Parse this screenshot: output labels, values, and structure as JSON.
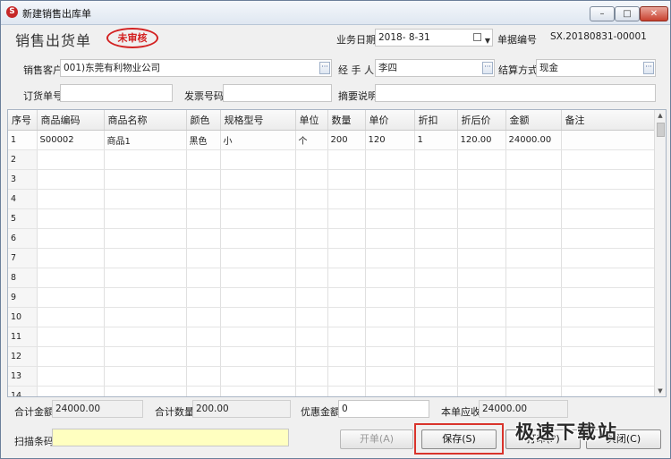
{
  "window": {
    "title": "新建销售出库单",
    "app_icon": "app-logo-icon",
    "controls": {
      "minimize": "–",
      "maximize": "□",
      "close": "✕"
    }
  },
  "header": {
    "doc_title": "销售出货单",
    "status_stamp": "未审核",
    "date_label": "业务日期",
    "date_value": "2018- 8-31",
    "doc_no_label": "单据编号",
    "doc_no_value": "SX.20180831-00001"
  },
  "form": {
    "customer_label": "销售客户",
    "customer_value": "001)东莞有利物业公司",
    "handler_label": "经 手 人",
    "handler_value": "李四",
    "settle_label": "结算方式",
    "settle_value": "现金",
    "order_no_label": "订货单号",
    "order_no_value": "",
    "invoice_no_label": "发票号码",
    "invoice_no_value": "",
    "remark_label": "摘要说明",
    "remark_value": "",
    "lookup_glyph": "···"
  },
  "grid": {
    "columns": [
      "序号",
      "商品编码",
      "商品名称",
      "颜色",
      "规格型号",
      "单位",
      "数量",
      "单价",
      "折扣",
      "折后价",
      "金额",
      "备注"
    ],
    "rows": [
      [
        "1",
        "S00002",
        "商品1",
        "黑色",
        "小",
        "个",
        "200",
        "120",
        "1",
        "120.00",
        "24000.00",
        ""
      ],
      [
        "2",
        "",
        "",
        "",
        "",
        "",
        "",
        "",
        "",
        "",
        "",
        ""
      ],
      [
        "3",
        "",
        "",
        "",
        "",
        "",
        "",
        "",
        "",
        "",
        "",
        ""
      ],
      [
        "4",
        "",
        "",
        "",
        "",
        "",
        "",
        "",
        "",
        "",
        "",
        ""
      ],
      [
        "5",
        "",
        "",
        "",
        "",
        "",
        "",
        "",
        "",
        "",
        "",
        ""
      ],
      [
        "6",
        "",
        "",
        "",
        "",
        "",
        "",
        "",
        "",
        "",
        "",
        ""
      ],
      [
        "7",
        "",
        "",
        "",
        "",
        "",
        "",
        "",
        "",
        "",
        "",
        ""
      ],
      [
        "8",
        "",
        "",
        "",
        "",
        "",
        "",
        "",
        "",
        "",
        "",
        ""
      ],
      [
        "9",
        "",
        "",
        "",
        "",
        "",
        "",
        "",
        "",
        "",
        "",
        ""
      ],
      [
        "10",
        "",
        "",
        "",
        "",
        "",
        "",
        "",
        "",
        "",
        "",
        ""
      ],
      [
        "11",
        "",
        "",
        "",
        "",
        "",
        "",
        "",
        "",
        "",
        "",
        ""
      ],
      [
        "12",
        "",
        "",
        "",
        "",
        "",
        "",
        "",
        "",
        "",
        "",
        ""
      ],
      [
        "13",
        "",
        "",
        "",
        "",
        "",
        "",
        "",
        "",
        "",
        "",
        ""
      ],
      [
        "14",
        "",
        "",
        "",
        "",
        "",
        "",
        "",
        "",
        "",
        "",
        ""
      ]
    ]
  },
  "totals": {
    "total_amount_label": "合计金额",
    "total_amount_value": "24000.00",
    "total_qty_label": "合计数量",
    "total_qty_value": "200.00",
    "discount_label": "优惠金额",
    "discount_value": "0",
    "receivable_label": "本单应收",
    "receivable_value": "24000.00"
  },
  "footer": {
    "barcode_label": "扫描条码",
    "barcode_value": "",
    "open_button": "开单(A)",
    "save_button": "保存(S)",
    "btn3_label": "打印(P)",
    "btn4_label": "关闭(C)",
    "highlight_color": "#d9342b",
    "barcode_bg": "#ffffc0"
  },
  "watermark": {
    "text": "极速下载站"
  }
}
